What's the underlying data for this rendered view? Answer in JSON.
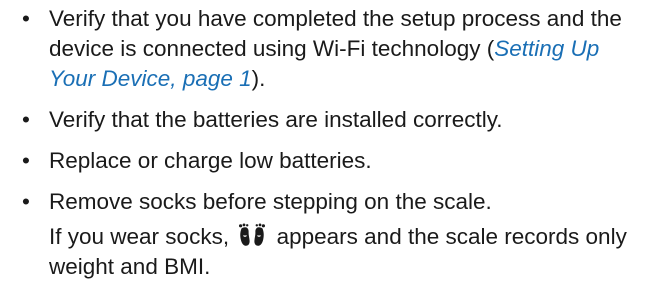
{
  "list": {
    "bullet_glyph": "•",
    "items": [
      {
        "text_before": "Verify that you have completed the setup process and the device is connected using Wi-Fi technology (",
        "link": "Setting Up Your Device, page 1",
        "text_after": ")."
      },
      {
        "text": "Verify that the batteries are installed correctly."
      },
      {
        "text": "Replace or charge low batteries."
      },
      {
        "text": "Remove socks before stepping on the scale.",
        "note_before": "If you wear socks,",
        "note_icon": "socks-icon",
        "note_after": "appears and the scale records only weight and BMI."
      }
    ]
  },
  "colors": {
    "text": "#1a1a1a",
    "link": "#1a6fb5"
  }
}
